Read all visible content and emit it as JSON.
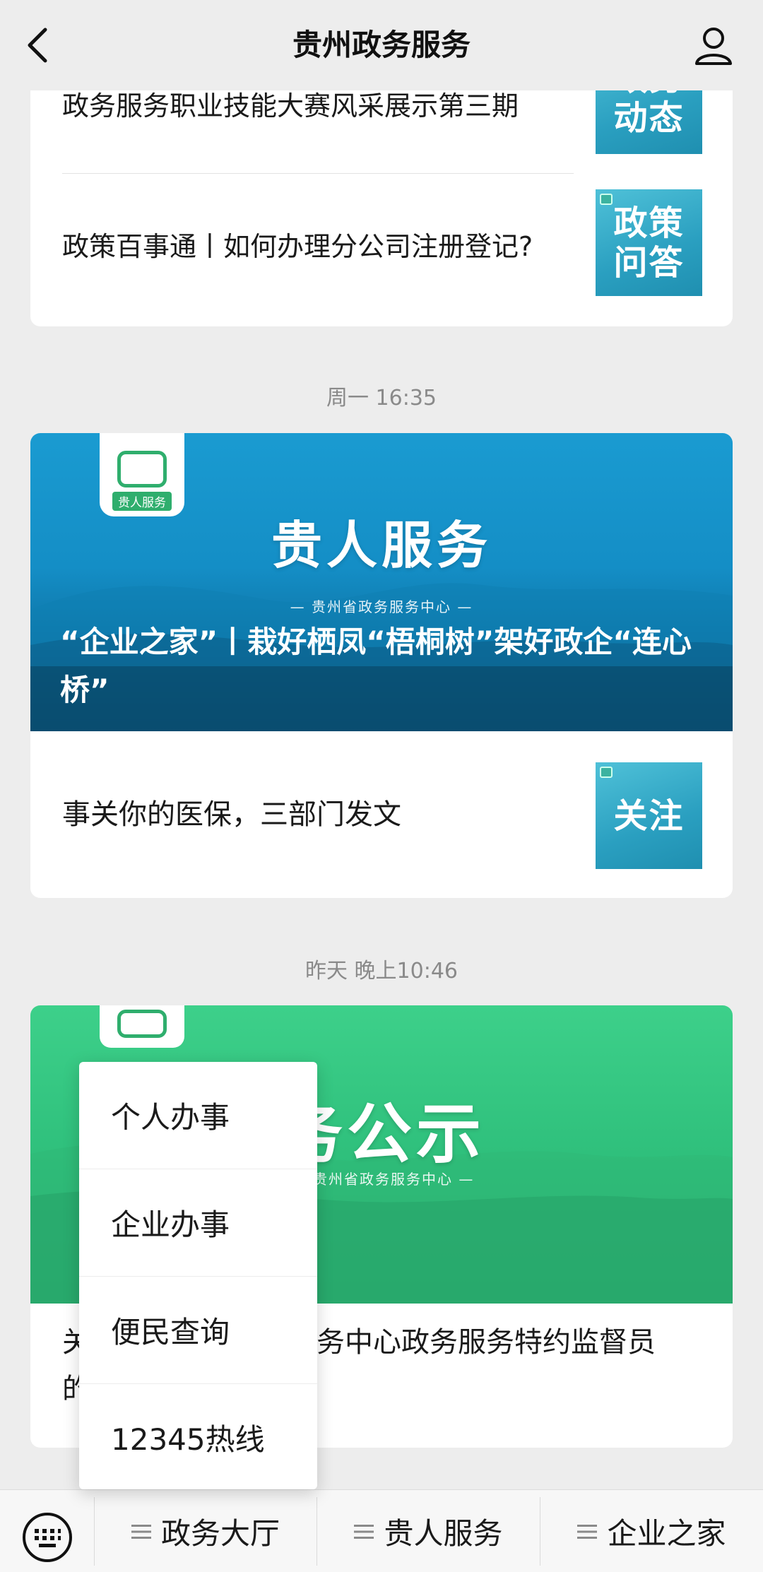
{
  "header": {
    "title": "贵州政务服务",
    "back_icon": "chevron-left-icon",
    "profile_icon": "user-icon"
  },
  "feed": {
    "card1": {
      "items": [
        {
          "title": "政务服务职业技能大赛风采展示第三期",
          "thumb_text": "政务动态"
        },
        {
          "title": "政策百事通丨如何办理分公司注册登记?",
          "thumb_text": "政策问答"
        }
      ]
    },
    "timestamp1": "周一 16:35",
    "card2": {
      "logo_label": "贵人服务",
      "banner_title": "贵人服务",
      "banner_sub": "— 贵州省政务服务中心 —",
      "headline": "“企业之家”丨栽好栖凤“梧桐树”架好政企“连心桥”",
      "item": {
        "title": "事关你的医保，三部门发文",
        "thumb_text": "关注"
      }
    },
    "timestamp2": "昨天 晚上10:46",
    "card3": {
      "banner_title": "务公示",
      "banner_sub": "贵州省政务服务中心 —",
      "headline_line1_left": "关",
      "headline_line1_right": "务中心政务服务特约监督员",
      "headline_line2_left": "的"
    }
  },
  "popup_menu": {
    "items": [
      "个人办事",
      "企业办事",
      "便民查询",
      "12345热线"
    ]
  },
  "bottom_menu": {
    "keyboard_icon": "keyboard-icon",
    "items": [
      "政务大厅",
      "贵人服务",
      "企业之家"
    ]
  },
  "colors": {
    "background": "#ededed",
    "blue_banner": "#1a9bd1",
    "green_banner": "#3dd08a",
    "thumb_blue": "#2a9fc0"
  }
}
